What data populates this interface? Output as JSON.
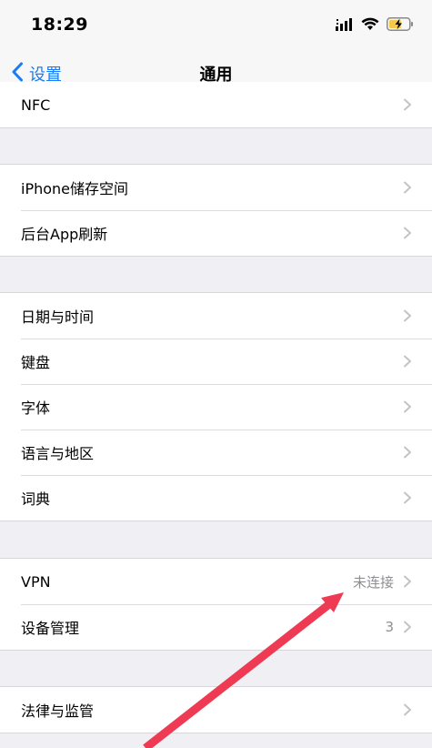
{
  "status_bar": {
    "time": "18:29"
  },
  "nav": {
    "back_label": "设置",
    "title": "通用"
  },
  "groups": [
    {
      "rows": [
        {
          "label": "NFC",
          "value": ""
        }
      ]
    },
    {
      "rows": [
        {
          "label": "iPhone储存空间",
          "value": ""
        },
        {
          "label": "后台App刷新",
          "value": ""
        }
      ]
    },
    {
      "rows": [
        {
          "label": "日期与时间",
          "value": ""
        },
        {
          "label": "键盘",
          "value": ""
        },
        {
          "label": "字体",
          "value": ""
        },
        {
          "label": "语言与地区",
          "value": ""
        },
        {
          "label": "词典",
          "value": ""
        }
      ]
    },
    {
      "rows": [
        {
          "label": "VPN",
          "value": "未连接"
        },
        {
          "label": "设备管理",
          "value": "3"
        }
      ]
    },
    {
      "rows": [
        {
          "label": "法律与监管",
          "value": ""
        }
      ]
    }
  ],
  "icons": {
    "back": "chevron-left-icon",
    "row_disclosure": "chevron-right-icon",
    "signal": "signal-icon",
    "wifi": "wifi-icon",
    "battery": "battery-charging-icon"
  },
  "colors": {
    "accent": "#1a7cf5",
    "annotation": "#ee3a52",
    "battery": "#f5c84a"
  }
}
